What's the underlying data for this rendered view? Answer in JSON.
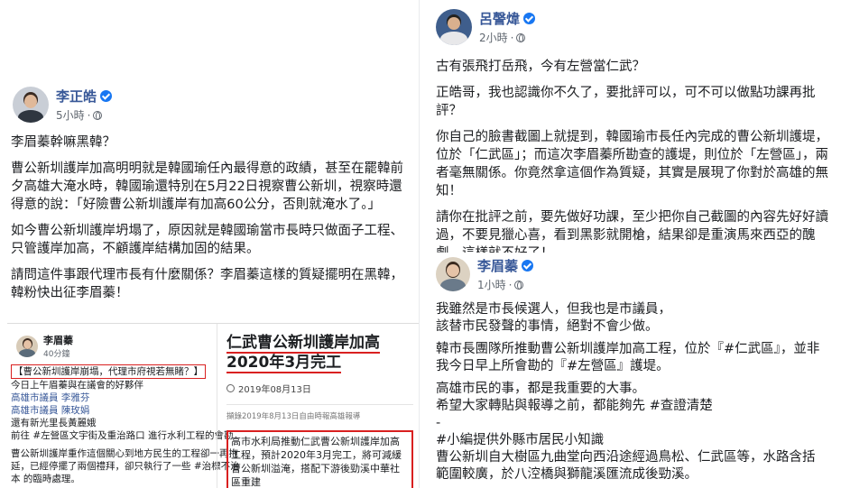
{
  "post_left": {
    "author": "李正皓",
    "time": "5小時",
    "paragraphs": [
      "李眉蓁幹嘛黑韓？",
      "曹公新圳護岸加高明明就是韓國瑜任內最得意的政績，甚至在罷韓前夕高雄大淹水時，韓國瑜還特別在5月22日視察曹公新圳，視察時還得意的說：「好險曹公新圳護岸有加高60公分，否則就淹水了。」",
      "如今曹公新圳護岸坍塌了，原因就是韓國瑜當市長時只做面子工程、只管護岸加高，不顧護岸結構加固的結果。",
      "請問這件事跟代理市長有什麼關係？李眉蓁這樣的質疑擺明在黑韓，韓粉快出征李眉蓁！"
    ],
    "embed": {
      "author": "李眉蓁",
      "time": "40分鐘",
      "lines": [
        "【曹公新圳護岸崩塌，代理市府視若無睹？】",
        "今日上午眉蓁與在議會的好夥伴",
        "高雄市議員 李雅芬",
        "高雄市議員 陳玫娟",
        "還有新光里長黃麗娥",
        "前往 #左營區文宇街及重治路口 進行水利工程的會勘",
        "",
        "曹公新圳護岸重作這個關心到地方民生的工程卻一再拖",
        "延，已經停擺了兩個禮拜，卻只執行了一些 #治標不治",
        "本 的臨時處理。"
      ],
      "headline": "仁武曹公新圳護岸加高 2020年3月完工",
      "date": "2019年08月13日",
      "caption": "擷錄2019年8月13日自由時報高雄報導",
      "body": "高市水利局推動仁武曹公新圳護岸加高工程，預計2020年3月完工，將可減緩曹公新圳溢淹，搭配下游後勁溪中華社區重建"
    }
  },
  "post_rt": {
    "author": "呂謦煒",
    "time": "2小時",
    "paragraphs": [
      "古有張飛打岳飛，今有左營當仁武？",
      "正皓哥，我也認識你不久了，要批評可以，可不可以做點功課再批評？",
      "你自己的臉書截圖上就提到，韓國瑜市長任內完成的曹公新圳護堤，位於「仁武區」；而這次李眉蓁所勘查的護堤，則位於「左營區」，兩者毫無關係。你竟然拿這個作為質疑，其實是展現了你對於高雄的無知！",
      "請你在批評之前，要先做好功課，至少把你自己截圖的內容先好好讀過，不要見獵心喜，看到黑影就開槍，結果卻是重演馬來西亞的醜劇，這樣就不好了！"
    ]
  },
  "post_rb": {
    "author": "李眉蓁",
    "time": "1小時",
    "lines": [
      "我雖然是市長候選人，但我也是市議員，",
      "該替市民發聲的事情，絕對不會少做。",
      "",
      "韓市長團隊所推動曹公新圳護岸加高工程，位於『#仁武區』，並非",
      "我今日早上所會勘的『#左營區』護堤。",
      "",
      "高雄市民的事，都是我重要的大事。",
      "希望大家轉貼與報導之前，都能夠先 #查證清楚",
      "-",
      "#小編提供外縣市居民小知識",
      "曹公新圳自大樹區九曲堂向西沿途經過鳥松、仁武區等，水路含括",
      "範圍較廣，於八涳橋與獅龍溪匯流成後勁溪。"
    ]
  }
}
